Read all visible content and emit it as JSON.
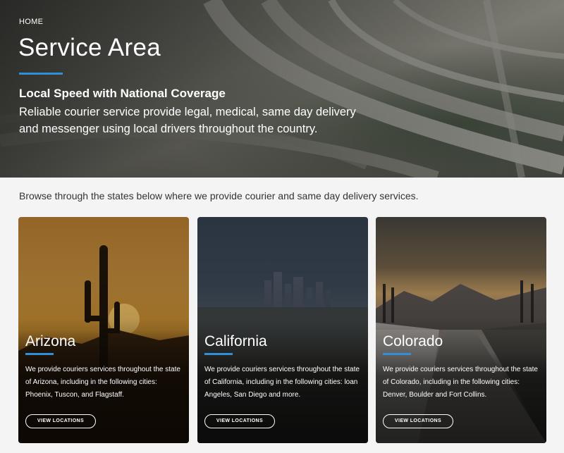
{
  "hero": {
    "breadcrumb": "HOME",
    "title": "Service Area",
    "subheading": "Local Speed with National Coverage",
    "lede": "Reliable courier service provide legal, medical, same day delivery and messenger using local drivers throughout the country."
  },
  "intro": "Browse through the states below where we provide courier and same day delivery services.",
  "cards": [
    {
      "name": "Arizona",
      "desc": "We provide couriers services throughout the state of Arizona, including in the following cities: Phoenix, Tuscon, and Flagstaff.",
      "button": "VIEW LOCATIONS"
    },
    {
      "name": "California",
      "desc": "We provide couriers services throughout the state of California, including in the following cities: loan Angeles, San Diego and more.",
      "button": "VIEW LOCATIONS"
    },
    {
      "name": "Colorado",
      "desc": "We provide couriers services throughout the state of Colorado, including in the following cities: Denver, Boulder and Fort Collins.",
      "button": "VIEW LOCATIONS"
    }
  ],
  "colors": {
    "accent": "#2f8fd8",
    "page_bg": "#f4f4f4"
  }
}
